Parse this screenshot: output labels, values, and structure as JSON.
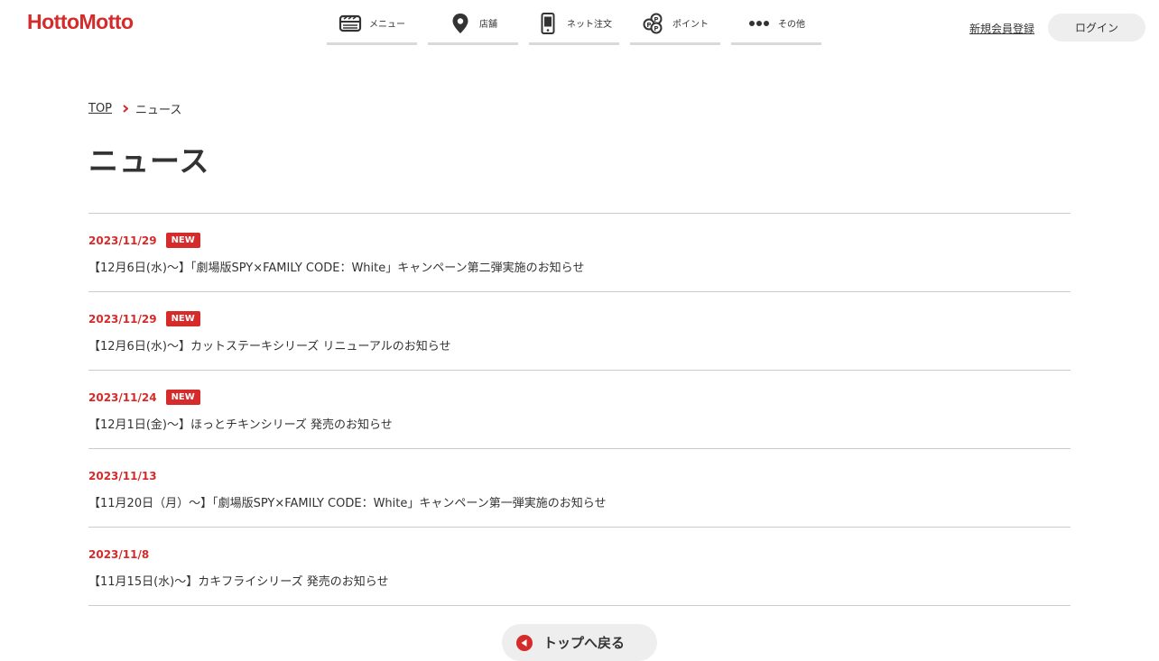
{
  "header": {
    "logo": "HottoMotto",
    "nav": [
      {
        "label": "メニュー",
        "icon": "bento-icon"
      },
      {
        "label": "店舗",
        "icon": "map-pin-icon"
      },
      {
        "label": "ネット注文",
        "icon": "smartphone-icon"
      },
      {
        "label": "ポイント",
        "icon": "coins-icon"
      },
      {
        "label": "その他",
        "icon": "more-dots-icon"
      }
    ],
    "signup_label": "新規会員登録",
    "login_label": "ログイン"
  },
  "breadcrumb": {
    "top": "TOP",
    "current": "ニュース"
  },
  "page_title": "ニュース",
  "news": [
    {
      "date": "2023/11/29",
      "badge": "NEW",
      "title": "【12月6日(水)〜】「劇場版SPY×FAMILY CODE：White」キャンペーン第二弾実施のお知らせ"
    },
    {
      "date": "2023/11/29",
      "badge": "NEW",
      "title": "【12月6日(水)〜】カットステーキシリーズ リニューアルのお知らせ"
    },
    {
      "date": "2023/11/24",
      "badge": "NEW",
      "title": "【12月1日(金)〜】ほっとチキンシリーズ 発売のお知らせ"
    },
    {
      "date": "2023/11/13",
      "badge": "",
      "title": "【11月20日（月）〜】「劇場版SPY×FAMILY CODE：White」キャンペーン第一弾実施のお知らせ"
    },
    {
      "date": "2023/11/8",
      "badge": "",
      "title": "【11月15日(水)〜】カキフライシリーズ 発売のお知らせ"
    }
  ],
  "back_label": "トップへ戻る",
  "colors": {
    "accent": "#d52b2b",
    "divider": "#cccccc",
    "button_bg": "#eeeeee"
  }
}
